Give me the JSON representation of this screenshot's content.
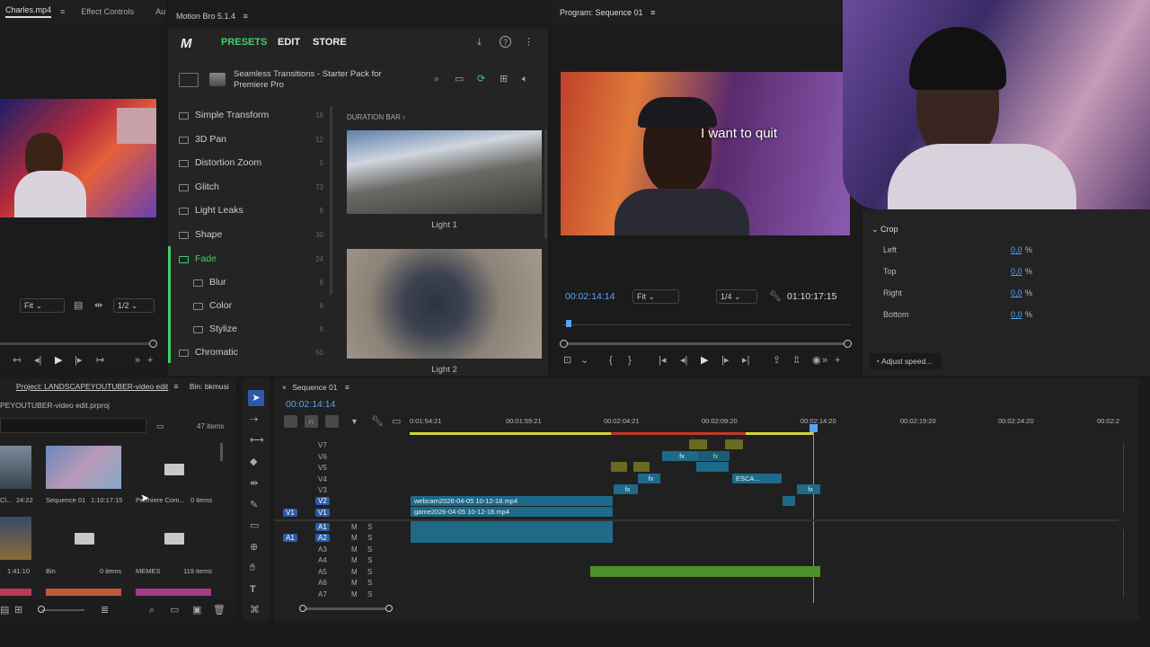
{
  "source": {
    "tab_file": "Charles.mp4",
    "tab_effects": "Effect Controls",
    "tab_audio": "Au",
    "fit": "Fit",
    "ratio": "1/2"
  },
  "motionbro": {
    "title": "Motion Bro 5.1.4",
    "nav": {
      "presets": "PRESETS",
      "edit": "EDIT",
      "store": "STORE"
    },
    "pack_title": "Seamless Transitions - Starter Pack for Premiere Pro",
    "section_label": "DURATION BAR",
    "categories": [
      {
        "label": "Simple Transform",
        "count": "18"
      },
      {
        "label": "3D Pan",
        "count": "12"
      },
      {
        "label": "Distortion Zoom",
        "count": "5"
      },
      {
        "label": "Glitch",
        "count": "73"
      },
      {
        "label": "Light Leaks",
        "count": "8"
      },
      {
        "label": "Shape",
        "count": "30"
      },
      {
        "label": "Fade",
        "count": "24"
      },
      {
        "label": "Blur",
        "count": "8"
      },
      {
        "label": "Color",
        "count": "8"
      },
      {
        "label": "Stylize",
        "count": "8"
      },
      {
        "label": "Chromatic",
        "count": "50"
      }
    ],
    "previews": [
      {
        "label": "Light 1"
      },
      {
        "label": "Light 2"
      }
    ]
  },
  "program": {
    "title": "Program: Sequence 01",
    "caption": "I want to quit",
    "timecode": "00:02:14:14",
    "fit": "Fit",
    "ratio": "1/4",
    "duration": "01:10:17:15"
  },
  "effects": {
    "crop_label": "Crop",
    "rows": [
      {
        "label": "Left",
        "value": "0,0",
        "unit": "%"
      },
      {
        "label": "Top",
        "value": "0,0",
        "unit": "%"
      },
      {
        "label": "Right",
        "value": "0,0",
        "unit": "%"
      },
      {
        "label": "Bottom",
        "value": "0,0",
        "unit": "%"
      }
    ],
    "adjust_speed": "Adjust speed..."
  },
  "project": {
    "tab": "Project: LANDSCAPEYOUTUBER-video edit",
    "tab_bin": "Bin: bkmusi",
    "path": "PEYOUTUBER-video edit.prproj",
    "items_count": "47 items",
    "items": [
      {
        "name": "Cl...",
        "meta": "24:22"
      },
      {
        "name": "Sequence 01",
        "meta": "1:10:17:15"
      },
      {
        "name": "Premiere Com...",
        "meta": "0 items"
      },
      {
        "name": "",
        "meta": "1:41:10"
      },
      {
        "name": "Bin",
        "meta": "0 items"
      },
      {
        "name": "MEMES",
        "meta": "119 items"
      }
    ]
  },
  "timeline": {
    "tab": "Sequence 01",
    "timecode": "00:02:14:14",
    "ruler": [
      "0:01:54:21",
      "00:01:59:21",
      "00:02:04:21",
      "00:02:09:20",
      "00:02:14:20",
      "00:02:19:20",
      "00:02:24:20",
      "00:02:2"
    ],
    "video_tracks": [
      "V7",
      "V6",
      "V5",
      "V4",
      "V3",
      "V2",
      "V1"
    ],
    "audio_tracks": [
      "A1",
      "A2",
      "A3",
      "A4",
      "A5",
      "A6",
      "A7"
    ],
    "src_v": "V1",
    "src_a": "A1",
    "clip_webcam": "webcam2026-04-05 10-12-18.mp4",
    "clip_game": "game2026-04-05 10-12-18.mp4",
    "clip_esca": "ESCA...",
    "fx": "fx",
    "mute": "M",
    "solo": "S"
  }
}
